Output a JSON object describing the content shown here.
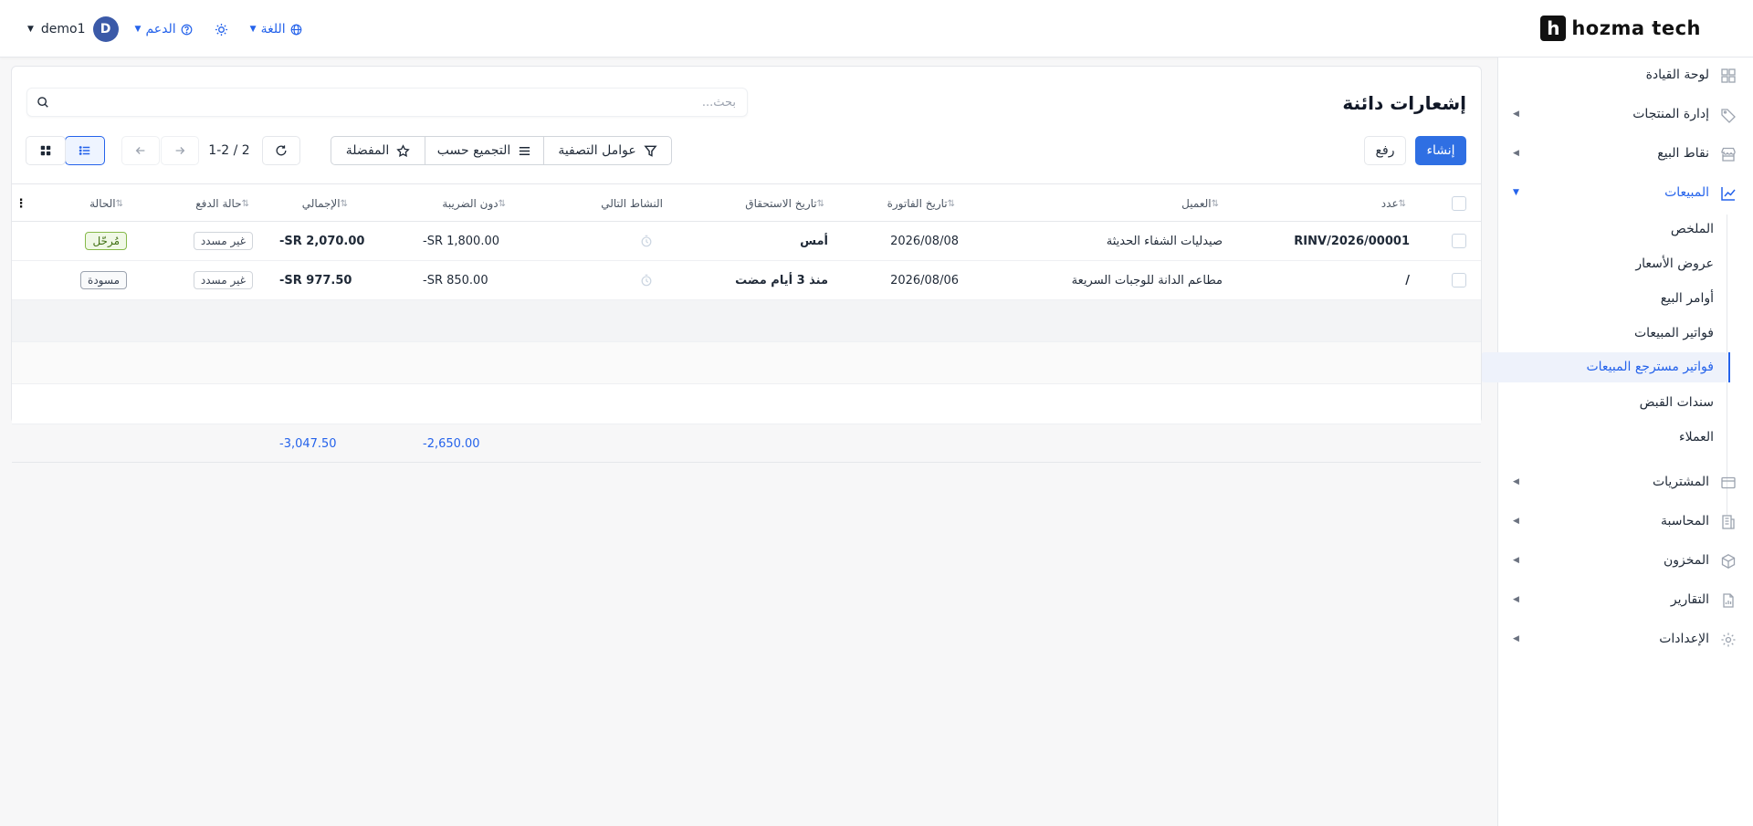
{
  "topbar": {
    "brand": "hozma tech",
    "user_name": "demo1",
    "user_initial": "D",
    "support_label": "الدعم",
    "language_label": "اللغة"
  },
  "sidebar": {
    "items": [
      {
        "label": "لوحة القيادة",
        "icon": "dashboard-icon"
      },
      {
        "label": "إدارة المنتجات",
        "icon": "tag-icon"
      },
      {
        "label": "نقاط البيع",
        "icon": "store-icon"
      },
      {
        "label": "المبيعات",
        "icon": "chart-icon"
      },
      {
        "label": "المشتريات",
        "icon": "card-icon"
      },
      {
        "label": "المحاسبة",
        "icon": "ledger-icon"
      },
      {
        "label": "المخزون",
        "icon": "box-icon"
      },
      {
        "label": "التقارير",
        "icon": "report-icon"
      },
      {
        "label": "الإعدادات",
        "icon": "gear-icon"
      }
    ],
    "sales_subitems": [
      "الملخص",
      "عروض الأسعار",
      "أوامر البيع",
      "فواتير المبيعات",
      "فواتير مسترجع المبيعات",
      "سندات القبض",
      "العملاء"
    ],
    "active_subitem": "فواتير مسترجع المبيعات"
  },
  "page": {
    "title": "إشعارات دائنة",
    "search_placeholder": "بحث...",
    "create_label": "إنشاء",
    "upload_label": "رفع",
    "filters_label": "عوامل التصفية",
    "group_by_label": "التجميع حسب",
    "favorites_label": "المفضلة",
    "pager": "1-2 / 2"
  },
  "table": {
    "columns": [
      "عدد",
      "العميل",
      "تاريخ الفاتورة",
      "تاريخ الاستحقاق",
      "النشاط التالي",
      "دون الضريبة",
      "الإجمالي",
      "حالة الدفع",
      "الحالة"
    ],
    "rows": [
      {
        "number": "RINV/2026/00001",
        "customer": "صيدليات الشفاء الحديثة",
        "invoice_date": "2026/08/08",
        "due_date": "أمس",
        "untaxed": "-SR 1,800.00",
        "total": "-SR 2,070.00",
        "payment_status": "غير مسدد",
        "status": "مُرحّل"
      },
      {
        "number": "/",
        "customer": "مطاعم الدانة للوجبات السريعة",
        "invoice_date": "2026/08/06",
        "due_date": "منذ 3 أيام مضت",
        "untaxed": "-SR 850.00",
        "total": "-SR 977.50",
        "payment_status": "غير مسدد",
        "status": "مسودة"
      }
    ],
    "totals": {
      "untaxed": "-2,650.00",
      "total": "-3,047.50"
    }
  },
  "colors": {
    "accent": "#2f6fe3",
    "posted_badge": "#86b94a"
  }
}
